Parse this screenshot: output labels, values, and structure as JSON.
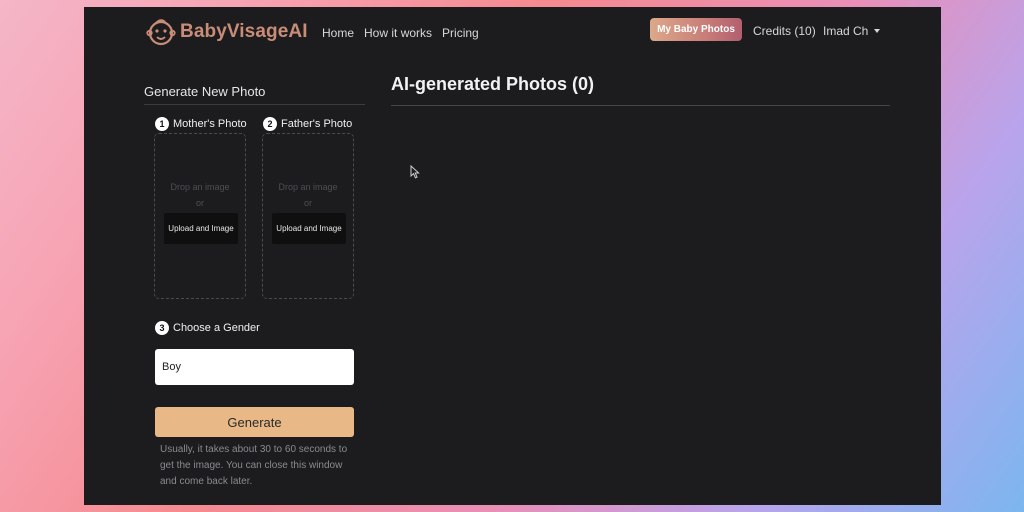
{
  "nav": {
    "brand": "BabyVisageAI",
    "links": [
      "Home",
      "How it works",
      "Pricing"
    ],
    "my_photos_label": "My Baby Photos",
    "credits_label": "Credits (10)",
    "user_label": "Imad Ch"
  },
  "generate": {
    "title": "Generate New Photo",
    "steps": [
      {
        "num": "1",
        "label": "Mother's Photo"
      },
      {
        "num": "2",
        "label": "Father's Photo"
      },
      {
        "num": "3",
        "label": "Choose a Gender"
      }
    ],
    "drop_text": "Drop an image",
    "or_text": "or",
    "upload_label": "Upload and Image",
    "gender_value": "Boy",
    "generate_label": "Generate",
    "hint": "Usually, it takes about 30 to 60 seconds to get the image. You can close this window and come back later."
  },
  "main": {
    "title": "AI-generated Photos (0)"
  },
  "colors": {
    "brand": "#c98d77",
    "accent": "#e8b987",
    "background": "#1c1c1f"
  },
  "icons": {
    "logo": "baby-face-icon",
    "caret": "caret-down-icon",
    "cursor": "mouse-pointer-icon"
  }
}
